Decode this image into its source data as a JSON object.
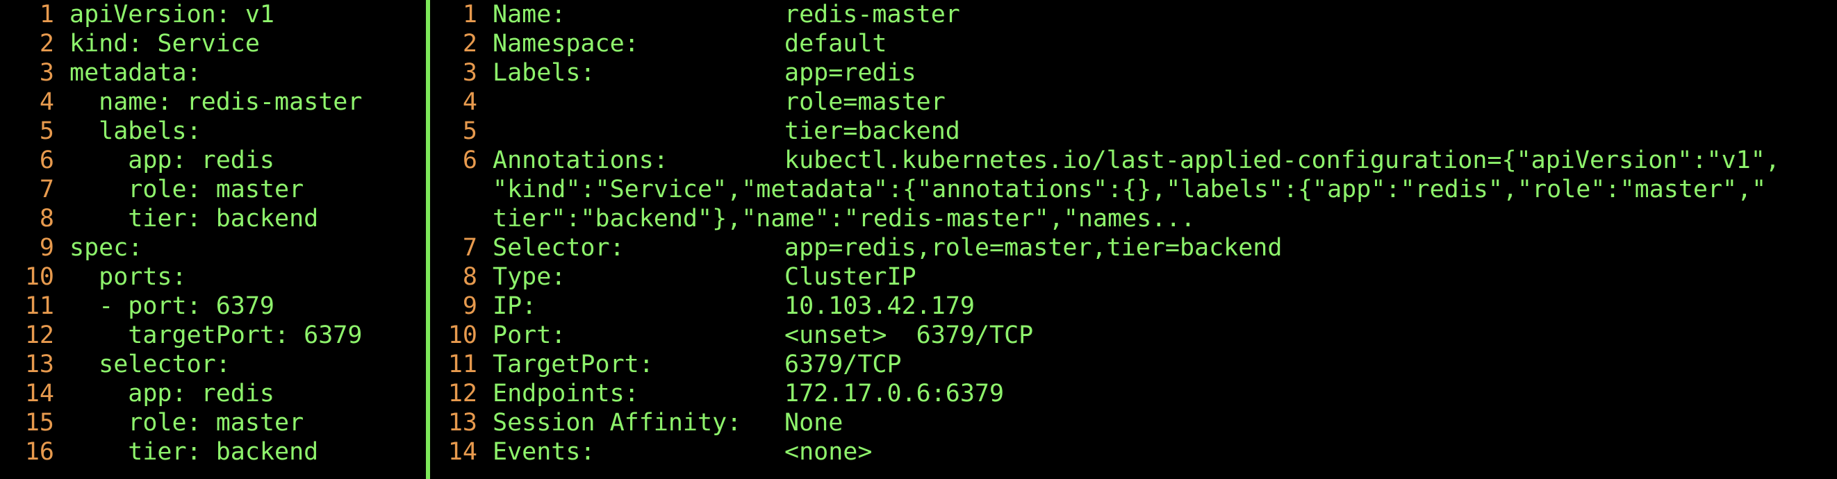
{
  "left_pane": {
    "lines": [
      {
        "n": "1",
        "text": "apiVersion: v1"
      },
      {
        "n": "2",
        "text": "kind: Service"
      },
      {
        "n": "3",
        "text": "metadata:"
      },
      {
        "n": "4",
        "text": "  name: redis-master"
      },
      {
        "n": "5",
        "text": "  labels:"
      },
      {
        "n": "6",
        "text": "    app: redis"
      },
      {
        "n": "7",
        "text": "    role: master"
      },
      {
        "n": "8",
        "text": "    tier: backend"
      },
      {
        "n": "9",
        "text": "spec:"
      },
      {
        "n": "10",
        "text": "  ports:"
      },
      {
        "n": "11",
        "text": "  - port: 6379"
      },
      {
        "n": "12",
        "text": "    targetPort: 6379"
      },
      {
        "n": "13",
        "text": "  selector:"
      },
      {
        "n": "14",
        "text": "    app: redis"
      },
      {
        "n": "15",
        "text": "    role: master"
      },
      {
        "n": "16",
        "text": "    tier: backend"
      }
    ]
  },
  "right_pane": {
    "lines": [
      {
        "n": "1",
        "key": "Name:",
        "value": "redis-master"
      },
      {
        "n": "2",
        "key": "Namespace:",
        "value": "default"
      },
      {
        "n": "3",
        "key": "Labels:",
        "value": "app=redis"
      },
      {
        "n": "4",
        "key": "",
        "value": "role=master"
      },
      {
        "n": "5",
        "key": "",
        "value": "tier=backend"
      },
      {
        "n": "6",
        "key": "Annotations:",
        "value": "kubectl.kubernetes.io/last-applied-configuration={\"apiVersion\":\"v1\","
      },
      {
        "n": "",
        "wrap": "\"kind\":\"Service\",\"metadata\":{\"annotations\":{},\"labels\":{\"app\":\"redis\",\"role\":\"master\",\""
      },
      {
        "n": "",
        "wrap": "tier\":\"backend\"},\"name\":\"redis-master\",\"names..."
      },
      {
        "n": "7",
        "key": "Selector:",
        "value": "app=redis,role=master,tier=backend"
      },
      {
        "n": "8",
        "key": "Type:",
        "value": "ClusterIP"
      },
      {
        "n": "9",
        "key": "IP:",
        "value": "10.103.42.179"
      },
      {
        "n": "10",
        "key": "Port:",
        "value": "<unset>  6379/TCP"
      },
      {
        "n": "11",
        "key": "TargetPort:",
        "value": "6379/TCP"
      },
      {
        "n": "12",
        "key": "Endpoints:",
        "value": "172.17.0.6:6379"
      },
      {
        "n": "13",
        "key": "Session Affinity:",
        "value": "None"
      },
      {
        "n": "14",
        "key": "Events:",
        "value": "<none>"
      }
    ]
  },
  "colors": {
    "background": "#000000",
    "line_number": "#e79a4e",
    "text": "#8ef36c",
    "divider": "#7ee85a"
  }
}
